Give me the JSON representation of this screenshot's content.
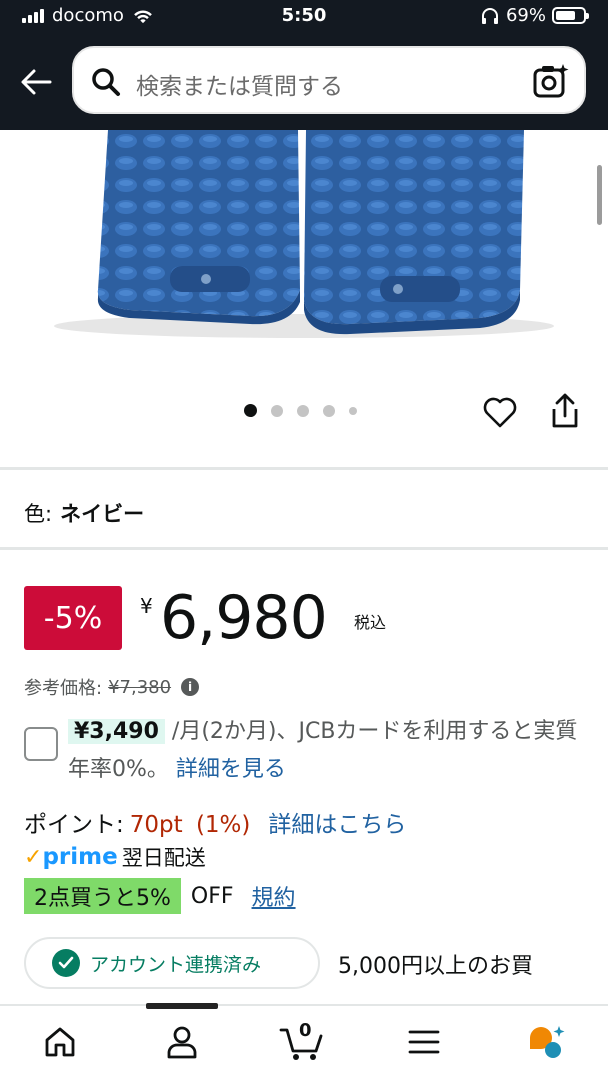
{
  "status_bar": {
    "carrier": "docomo",
    "time": "5:50",
    "battery": "69%",
    "battery_level": 0.69
  },
  "header": {
    "search_placeholder": "検索または質問する"
  },
  "gallery": {
    "image_count": 5,
    "active_index": 0
  },
  "variant": {
    "label": "色:",
    "value": "ネイビー"
  },
  "pricing": {
    "discount": "-5%",
    "currency_symbol": "¥",
    "price": "6,980",
    "tax_label": "税込",
    "reference_label": "参考価格:",
    "reference_price": "¥7,380"
  },
  "installment": {
    "amount": "¥3,490",
    "text": "/月(2か月)、JCBカードを利用すると実質年率0%。",
    "link": "詳細を見る"
  },
  "points": {
    "label": "ポイント:",
    "value": "70pt",
    "percent": "(1%)",
    "link": "詳細はこちら"
  },
  "delivery": {
    "prime": "prime",
    "text": "翌日配送"
  },
  "promotion": {
    "tag": "2点買うと5%",
    "suffix": "OFF",
    "link": "規約"
  },
  "account": {
    "pill": "アカウント連携済み",
    "offer": "5,000円以上のお買"
  },
  "bottom_nav": {
    "cart_count": "0"
  },
  "colors": {
    "header_bg": "#131921",
    "deal_red": "#cc0c39",
    "link_blue": "#2162a1",
    "points_red": "#b12704",
    "promo_green": "#7fda69",
    "prime_blue": "#1a98ff"
  }
}
